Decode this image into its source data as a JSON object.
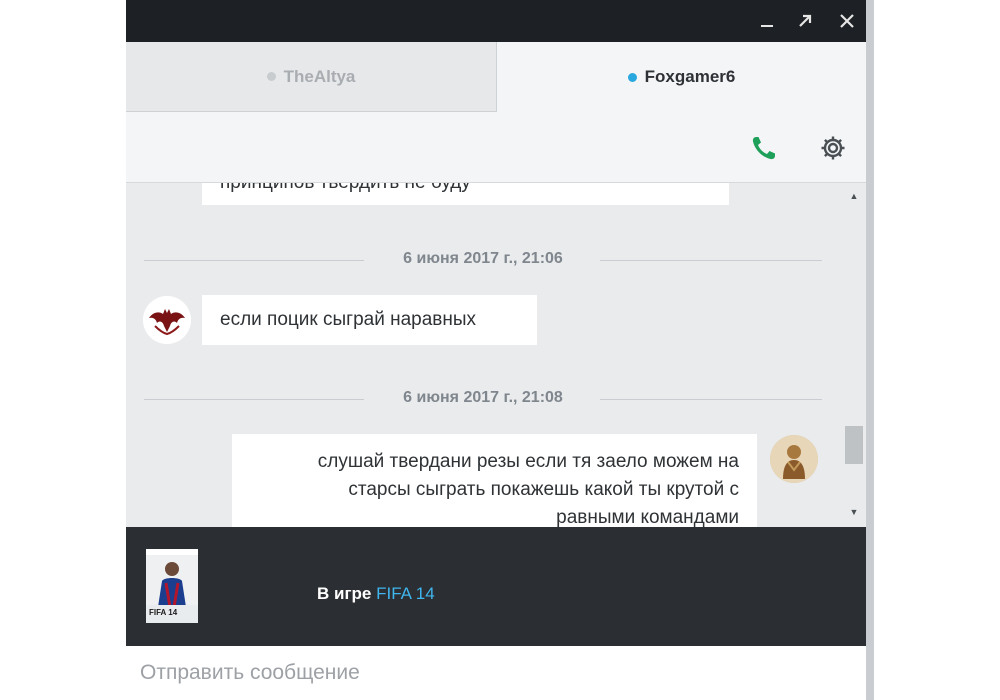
{
  "window_controls": {
    "minimize": "–",
    "maximize": "⤢",
    "close": "✕"
  },
  "tabs": [
    {
      "label": "TheAltya",
      "status": "offline"
    },
    {
      "label": "Foxgamer6",
      "status": "online"
    }
  ],
  "toolbar": {
    "call_icon": "phone-icon",
    "settings_icon": "gear-icon",
    "call_color": "#1fa05a"
  },
  "messages": {
    "partial_top": "принципов твердить не буду",
    "divider_1": "6 июня 2017 г., 21:06",
    "message_1": "если поцик сыграй наравных",
    "divider_2": "6 июня 2017 г., 21:08",
    "message_2_lines": [
      "слушай твердани резы если тя заело можем на",
      "старсы сыграть покажешь какой ты крутой с",
      "равными командами"
    ]
  },
  "game": {
    "prefix": "В игре",
    "name": "FIFA 14",
    "cover_text": "FIFA 14"
  },
  "composer": {
    "placeholder": "Отправить сообщение"
  }
}
